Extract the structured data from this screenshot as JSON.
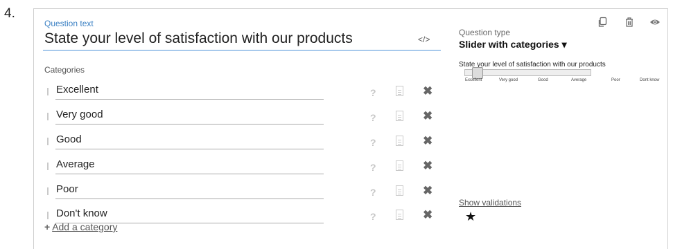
{
  "question_number": "4.",
  "editor": {
    "question_text_label": "Question text",
    "question_text": "State your level of satisfaction with our products",
    "code_icon": "</>",
    "categories_label": "Categories",
    "categories": [
      {
        "label": "Excellent"
      },
      {
        "label": "Very good"
      },
      {
        "label": "Good"
      },
      {
        "label": "Average"
      },
      {
        "label": "Poor"
      },
      {
        "label": "Don't know"
      }
    ],
    "help_glyph": "?",
    "delete_glyph": "✖",
    "add_category": "Add a category"
  },
  "toolbar": {
    "icons": [
      "duplicate-icon",
      "delete-icon",
      "preview-eye-icon"
    ]
  },
  "question_type": {
    "label": "Question type",
    "value": "Slider with categories ▾"
  },
  "preview": {
    "question": "State your level of satisfaction with our products",
    "tick_labels": [
      "Excellent",
      "Very good",
      "Good",
      "Average",
      "Poor",
      "Dont know"
    ]
  },
  "validations": {
    "link": "Show validations",
    "required_icon": "★"
  },
  "colors": {
    "accent": "#3d82c4",
    "border": "#cfcfcf"
  }
}
